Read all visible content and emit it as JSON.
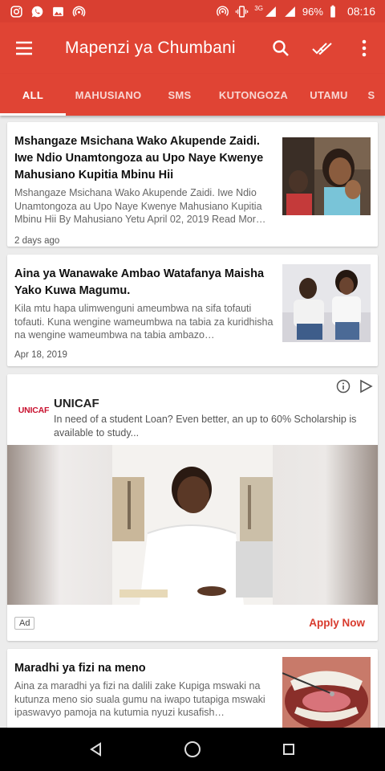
{
  "status_bar": {
    "network": "3G",
    "battery": "96%",
    "time": "08:16",
    "left_icons": [
      "instagram-icon",
      "whatsapp-icon",
      "image-icon",
      "cast-icon"
    ],
    "right_icons": [
      "hotspot-icon",
      "vibrate-icon",
      "signal-icon",
      "battery-icon"
    ]
  },
  "app_bar": {
    "title": "Mapenzi ya Chumbani",
    "menu_icon": "hamburger-menu-icon",
    "actions": [
      "search-icon",
      "double-check-icon",
      "more-vertical-icon"
    ],
    "color": "#e04434"
  },
  "tabs": [
    {
      "label": "ALL",
      "active": true
    },
    {
      "label": "MAHUSIANO",
      "active": false
    },
    {
      "label": "SMS",
      "active": false
    },
    {
      "label": "KUTONGOZA",
      "active": false
    },
    {
      "label": "UTAMU",
      "active": false
    },
    {
      "label": "S",
      "active": false
    }
  ],
  "articles": [
    {
      "title": "Mshangaze Msichana Wako Akupende Zaidi. Iwe Ndio Unamtongoza au Upo Naye Kwenye Mahusiano Kupitia Mbinu Hii",
      "excerpt": "Mshangaze Msichana Wako Akupende Zaidi. Iwe Ndio Unamtongoza au Upo Naye Kwenye Mahusiano Kupitia Mbinu Hii By Mahusiano Yetu April 02, 2019 Read Mor…",
      "date": "2 days ago"
    },
    {
      "title": "Aina ya Wanawake Ambao Watafanya Maisha Yako Kuwa Magumu.",
      "excerpt": "Kila mtu hapa ulimwenguni ameumbwa na sifa tofauti tofauti. Kuna wengine wameumbwa na tabia za kuridhisha na wengine wameumbwa na tabia ambazo…",
      "date": "Apr 18, 2019"
    },
    {
      "title": "Maradhi ya fizi na meno",
      "excerpt": "Aina za maradhi ya fizi na dalili zake Kupiga mswaki na kutunza meno sio suala gumu na iwapo tutapiga mswaki ipaswavyo pamoja na kutumia nyuzi kusafish…",
      "date": ""
    }
  ],
  "ad": {
    "logo_text": "UNICAF",
    "advertiser": "UNICAF",
    "description": "In need of a student Loan? Even better, an up to 60% Scholarship is available to study...",
    "badge": "Ad",
    "cta": "Apply Now",
    "cta_color": "#d83b2e",
    "icons": [
      "info-icon",
      "adchoices-icon"
    ]
  },
  "nav_bar": {
    "buttons": [
      "back-icon",
      "home-icon",
      "recents-icon"
    ]
  }
}
